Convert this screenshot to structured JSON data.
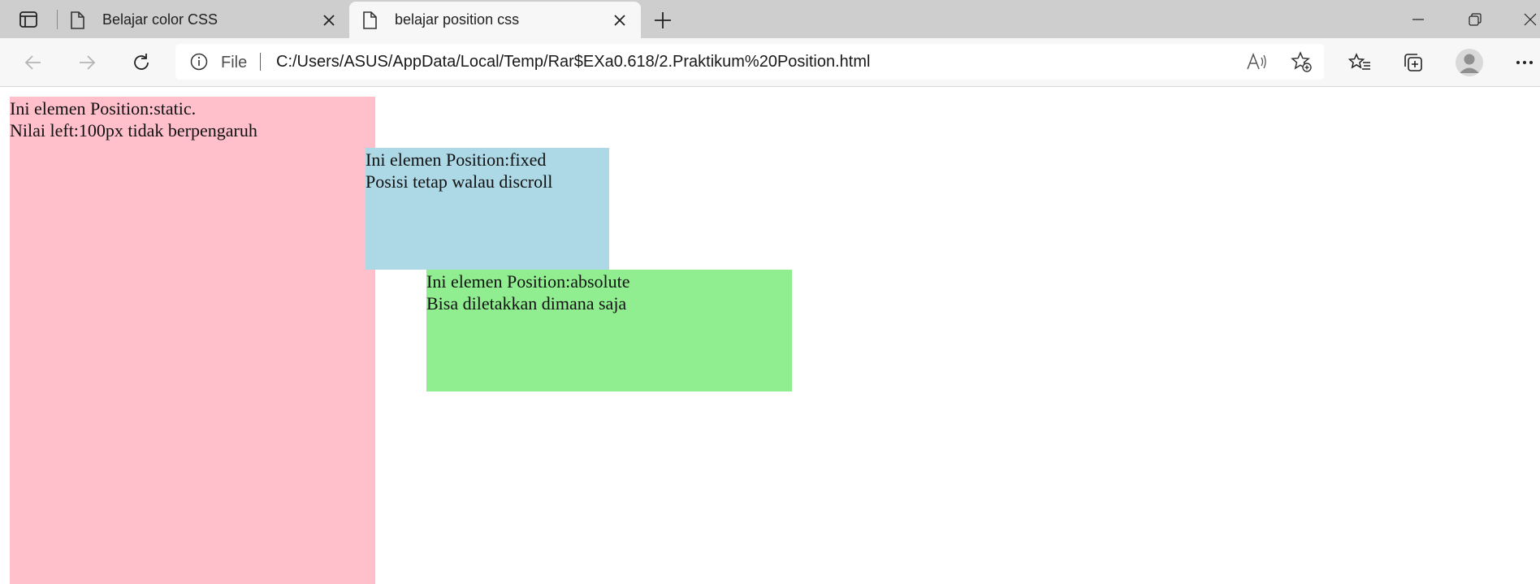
{
  "tabs": [
    {
      "title": "Belajar color CSS",
      "active": false
    },
    {
      "title": "belajar position css",
      "active": true
    }
  ],
  "address_bar": {
    "protocol": "File",
    "url": "C:/Users/ASUS/AppData/Local/Temp/Rar$EXa0.618/2.Praktikum%20Position.html"
  },
  "page": {
    "static_box": {
      "line1": "Ini elemen Position:static.",
      "line2": "Nilai left:100px tidak berpengaruh",
      "color": "#ffc0cb"
    },
    "fixed_box": {
      "line1": "Ini elemen Position:fixed",
      "line2": "Posisi tetap walau discroll",
      "color": "#add8e6"
    },
    "absolute_box": {
      "line1": "Ini elemen Position:absolute",
      "line2": "Bisa diletakkan dimana saja",
      "color": "#90ee90"
    }
  },
  "icons": {
    "tab_actions": "tab-actions-icon",
    "page": "page-icon",
    "close": "close-icon",
    "new_tab": "plus-icon",
    "minimize": "minimize-icon",
    "restore": "restore-icon",
    "close_window": "close-window-icon",
    "back": "back-arrow-icon",
    "forward": "forward-arrow-icon",
    "refresh": "refresh-icon",
    "info": "info-icon",
    "read_aloud": "read-aloud-icon",
    "add_favorite": "add-favorite-icon",
    "favorites": "favorites-icon",
    "collections": "collections-icon",
    "profile": "profile-avatar",
    "menu": "more-menu-icon"
  }
}
